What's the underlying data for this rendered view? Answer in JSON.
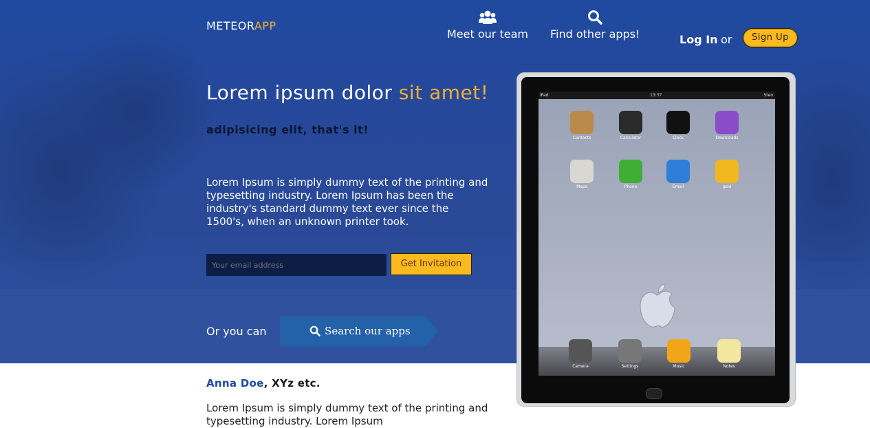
{
  "header": {
    "brand_main": "METEOR",
    "brand_accent": "APP",
    "nav": [
      {
        "label": "Meet our team",
        "icon": "users-icon"
      },
      {
        "label": "Find other apps!",
        "icon": "search-icon"
      }
    ],
    "login_label": "Log In",
    "or_text": "or",
    "signup_label": "Sign Up"
  },
  "hero": {
    "headline_main": "Lorem ipsum dolor ",
    "headline_accent": "sit amet!",
    "subhead": "adipisicing elit, that's it!",
    "paragraph": "Lorem Ipsum is simply dummy text of the printing and typesetting industry. Lorem Ipsum has been the industry's standard dummy text ever since the 1500's, when an unknown printer took.",
    "email_placeholder": "Your email address",
    "invite_label": "Get Invitation",
    "or_you_can": "Or you can",
    "search_apps_label": "Search our apps"
  },
  "testimonial": {
    "name": "Anna Doe",
    "rest": ", XYz etc.",
    "text": "Lorem Ipsum is simply dummy text of the printing and typesetting industry. Lorem Ipsum"
  },
  "device": {
    "status_left": "iPad",
    "status_time": "13:37",
    "status_right": "Steo",
    "apps": [
      {
        "label": "Contacts",
        "icon": "contacts-icon",
        "color": "#b98a4a"
      },
      {
        "label": "Calculator",
        "icon": "calculator-icon",
        "color": "#2b2b2b"
      },
      {
        "label": "Clock",
        "icon": "clock-icon",
        "color": "#111111"
      },
      {
        "label": "Downloads",
        "icon": "downloads-icon",
        "color": "#8a4cc8"
      },
      {
        "label": "Maps",
        "icon": "maps-icon",
        "color": "#d8d8d0"
      },
      {
        "label": "Phone",
        "icon": "phone-icon",
        "color": "#3fae35"
      },
      {
        "label": "Email",
        "icon": "email-icon",
        "color": "#2f7fd8"
      },
      {
        "label": "Ipod",
        "icon": "ipod-icon",
        "color": "#f0b81e"
      }
    ],
    "dock": [
      {
        "label": "Camera",
        "icon": "camera-icon",
        "color": "#555555"
      },
      {
        "label": "Settings",
        "icon": "settings-icon",
        "color": "#777777"
      },
      {
        "label": "Music",
        "icon": "music-icon",
        "color": "#f3a51a"
      },
      {
        "label": "Notes",
        "icon": "notes-icon",
        "color": "#f3e7a0"
      }
    ]
  },
  "colors": {
    "hero_blue": "#2a4a98",
    "accent_orange": "#f5ae33",
    "button_yellow": "#fdba1f",
    "search_button_blue": "#2361a8"
  }
}
